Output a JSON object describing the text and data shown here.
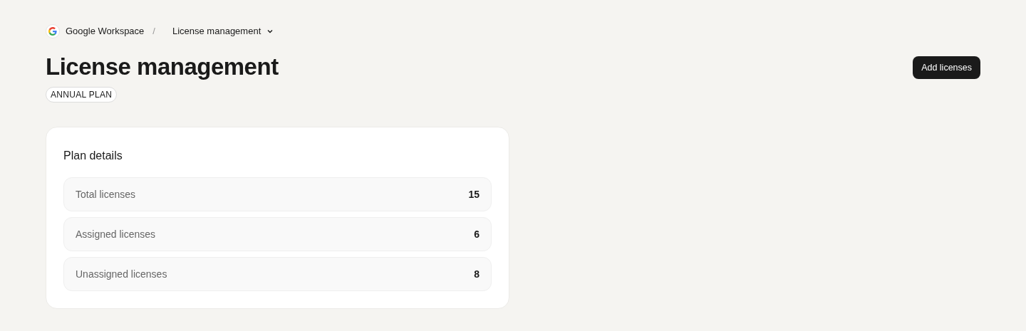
{
  "breadcrumb": [
    {
      "label": "Google Workspace"
    },
    {
      "label": "License management"
    }
  ],
  "breadcrumb_separator": "/",
  "title": "License management",
  "badge": "ANNUAL PLAN",
  "action_button": "Add licenses",
  "plan_details": {
    "heading": "Plan details",
    "rows": [
      {
        "label": "Total licenses",
        "value": "15"
      },
      {
        "label": "Assigned licenses",
        "value": "6"
      },
      {
        "label": "Unassigned licenses",
        "value": "8"
      }
    ]
  }
}
